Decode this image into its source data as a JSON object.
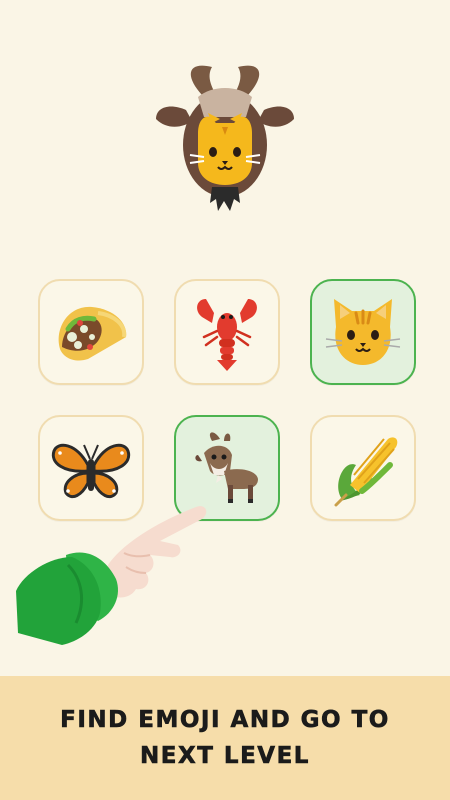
{
  "target": {
    "icon": "goat-cat-emoji-mashup-icon"
  },
  "grid": {
    "items": [
      {
        "icon": "taco-icon",
        "selected": false
      },
      {
        "icon": "lobster-icon",
        "selected": false
      },
      {
        "icon": "cat-face-icon",
        "selected": true
      },
      {
        "icon": "butterfly-icon",
        "selected": false
      },
      {
        "icon": "goat-icon",
        "selected": true
      },
      {
        "icon": "corn-icon",
        "selected": false
      }
    ]
  },
  "hint": {
    "icon": "pointing-hand-icon"
  },
  "footer": {
    "line1": "FIND EMOJI AND GO TO",
    "line2": "NEXT LEVEL"
  },
  "colors": {
    "background": "#faf5e6",
    "tile_border": "#f0dcb0",
    "selected_border": "#4cb34f",
    "selected_fill": "#e3f1dd",
    "footer": "#f6ddaa",
    "sleeve": "#22a33a"
  }
}
